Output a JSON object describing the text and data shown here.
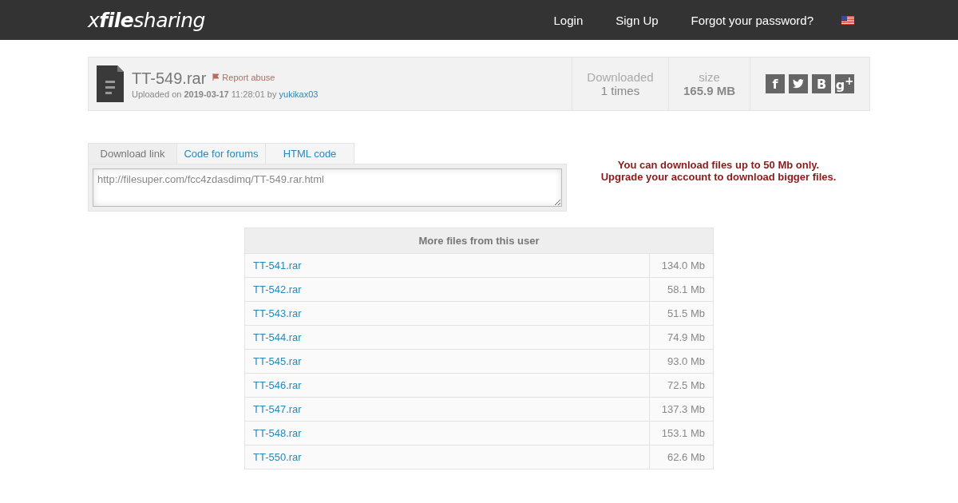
{
  "header": {
    "logo": "x**file**sharing",
    "nav": [
      "Login",
      "Sign Up",
      "Forgot your password?"
    ]
  },
  "file": {
    "name": "TT-549.rar",
    "report": "Report abuse",
    "uploaded_prefix": "Uploaded on",
    "date": "2019-03-17",
    "time": "11:28:01 by",
    "user": "yukikax03"
  },
  "stats": [
    {
      "label": "Downloaded",
      "value": "1 times",
      "bold": false
    },
    {
      "label": "size",
      "value": "165.9 MB",
      "bold": true
    }
  ],
  "share": [
    {
      "kind": "text",
      "label": "f"
    },
    {
      "kind": "bird"
    },
    {
      "kind": "text",
      "label": "B"
    },
    {
      "kind": "text",
      "label": "g$^{+}$"
    }
  ],
  "tabs": [
    {
      "label": "Download link",
      "selected": true
    },
    {
      "label": "Code for forums",
      "selected": false
    },
    {
      "label": "HTML code",
      "selected": false
    }
  ],
  "link_value": "http://filesuper.com/fcc4zdasdimq/TT-549.rar.html",
  "notice": [
    "You can download files up to 50 Mb only.",
    "Upgrade your account to download bigger files."
  ],
  "more_files": {
    "title": "More files from this user",
    "rows": [
      {
        "name": "TT-541.rar",
        "size": "134.0 Mb"
      },
      {
        "name": "TT-542.rar",
        "size": "58.1 Mb"
      },
      {
        "name": "TT-543.rar",
        "size": "51.5 Mb"
      },
      {
        "name": "TT-544.rar",
        "size": "74.9 Mb"
      },
      {
        "name": "TT-545.rar",
        "size": "93.0 Mb"
      },
      {
        "name": "TT-546.rar",
        "size": "72.5 Mb"
      },
      {
        "name": "TT-547.rar",
        "size": "137.3 Mb"
      },
      {
        "name": "TT-548.rar",
        "size": "153.1 Mb"
      },
      {
        "name": "TT-550.rar",
        "size": "62.6 Mb"
      }
    ]
  }
}
